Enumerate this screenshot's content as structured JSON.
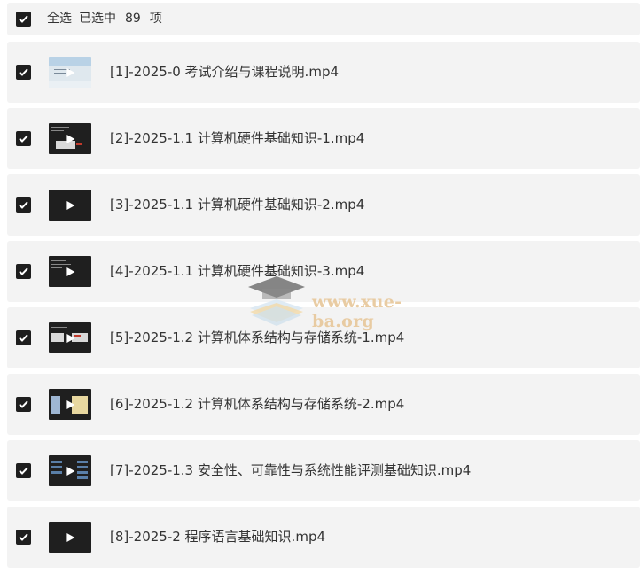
{
  "header": {
    "select_all": "全选",
    "selected_prefix": "已选中",
    "count": "89",
    "unit": "项"
  },
  "items": [
    {
      "title": "[1]-2025-0 考试介绍与课程说明.mp4",
      "checked": true
    },
    {
      "title": "[2]-2025-1.1 计算机硬件基础知识-1.mp4",
      "checked": true
    },
    {
      "title": "[3]-2025-1.1 计算机硬件基础知识-2.mp4",
      "checked": true
    },
    {
      "title": "[4]-2025-1.1 计算机硬件基础知识-3.mp4",
      "checked": true
    },
    {
      "title": "[5]-2025-1.2 计算机体系结构与存储系统-1.mp4",
      "checked": true
    },
    {
      "title": "[6]-2025-1.2 计算机体系结构与存储系统-2.mp4",
      "checked": true
    },
    {
      "title": "[7]-2025-1.3 安全性、可靠性与系统性能评测基础知识.mp4",
      "checked": true
    },
    {
      "title": "[8]-2025-2 程序语言基础知识.mp4",
      "checked": true
    }
  ],
  "watermark": {
    "text": "www.xue-ba.org"
  },
  "colors": {
    "row_bg": "#f3f3f3",
    "checkbox": "#1e1e1e",
    "text": "#333333",
    "watermark": "#e7c79a"
  }
}
